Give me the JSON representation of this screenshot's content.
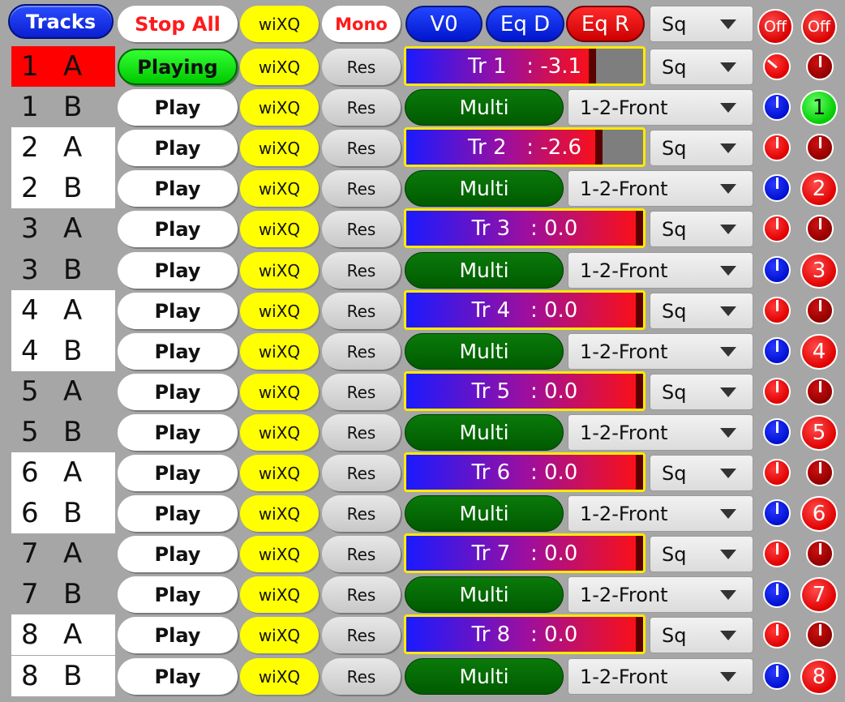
{
  "header": {
    "tracks_label": "Tracks",
    "stop_all_label": "Stop All",
    "wixq_label": "wiXQ",
    "mono_label": "Mono",
    "v0_label": "V0",
    "eqd_label": "Eq D",
    "eqr_label": "Eq R",
    "sq_value": "Sq",
    "off1_label": "Off",
    "off2_label": "Off"
  },
  "colors": {
    "label_red": "#ff0000",
    "label_white": "#ffffff",
    "label_gray": "#a6a6a6",
    "meter_border": "#ffea00",
    "multi_green": "#006400",
    "wixq_yellow": "#ffff00"
  },
  "rows": [
    {
      "num": "1",
      "side": "A",
      "label_bg": "label_red",
      "play": "Playing",
      "wixq": "wiXQ",
      "res": "Res",
      "kind": "meter",
      "meter_text": "Tr 1   : -3.1",
      "level": 0.8,
      "sq": "Sq",
      "knob1": "red",
      "knob2": "dred",
      "knob1_rot": -50,
      "knob2_rot": 0
    },
    {
      "num": "1",
      "side": "B",
      "label_bg": "label_gray",
      "play": "Play",
      "wixq": "wiXQ",
      "res": "Res",
      "kind": "multi",
      "multi": "Multi",
      "out": "1-2-Front",
      "knob1": "blue",
      "knob1_rot": 0,
      "num_btn": "1",
      "num_btn_color": "green"
    },
    {
      "num": "2",
      "side": "A",
      "label_bg": "label_white",
      "play": "Play",
      "wixq": "wiXQ",
      "res": "Res",
      "kind": "meter",
      "meter_text": "Tr 2   : -2.6",
      "level": 0.83,
      "sq": "Sq",
      "knob1": "red",
      "knob2": "dred",
      "knob1_rot": 0,
      "knob2_rot": 0
    },
    {
      "num": "2",
      "side": "B",
      "label_bg": "label_white",
      "play": "Play",
      "wixq": "wiXQ",
      "res": "Res",
      "kind": "multi",
      "multi": "Multi",
      "out": "1-2-Front",
      "knob1": "blue",
      "knob1_rot": 0,
      "num_btn": "2",
      "num_btn_color": "red"
    },
    {
      "num": "3",
      "side": "A",
      "label_bg": "label_gray",
      "play": "Play",
      "wixq": "wiXQ",
      "res": "Res",
      "kind": "meter",
      "meter_text": "Tr 3   : 0.0",
      "level": 1.0,
      "sq": "Sq",
      "knob1": "red",
      "knob2": "dred",
      "knob1_rot": 0,
      "knob2_rot": 0
    },
    {
      "num": "3",
      "side": "B",
      "label_bg": "label_gray",
      "play": "Play",
      "wixq": "wiXQ",
      "res": "Res",
      "kind": "multi",
      "multi": "Multi",
      "out": "1-2-Front",
      "knob1": "blue",
      "knob1_rot": 0,
      "num_btn": "3",
      "num_btn_color": "red"
    },
    {
      "num": "4",
      "side": "A",
      "label_bg": "label_white",
      "play": "Play",
      "wixq": "wiXQ",
      "res": "Res",
      "kind": "meter",
      "meter_text": "Tr 4   : 0.0",
      "level": 1.0,
      "sq": "Sq",
      "knob1": "red",
      "knob2": "dred",
      "knob1_rot": 0,
      "knob2_rot": 0
    },
    {
      "num": "4",
      "side": "B",
      "label_bg": "label_white",
      "play": "Play",
      "wixq": "wiXQ",
      "res": "Res",
      "kind": "multi",
      "multi": "Multi",
      "out": "1-2-Front",
      "knob1": "blue",
      "knob1_rot": 0,
      "num_btn": "4",
      "num_btn_color": "red"
    },
    {
      "num": "5",
      "side": "A",
      "label_bg": "label_gray",
      "play": "Play",
      "wixq": "wiXQ",
      "res": "Res",
      "kind": "meter",
      "meter_text": "Tr 5   : 0.0",
      "level": 1.0,
      "sq": "Sq",
      "knob1": "red",
      "knob2": "dred",
      "knob1_rot": 0,
      "knob2_rot": 0
    },
    {
      "num": "5",
      "side": "B",
      "label_bg": "label_gray",
      "play": "Play",
      "wixq": "wiXQ",
      "res": "Res",
      "kind": "multi",
      "multi": "Multi",
      "out": "1-2-Front",
      "knob1": "blue",
      "knob1_rot": 0,
      "num_btn": "5",
      "num_btn_color": "red"
    },
    {
      "num": "6",
      "side": "A",
      "label_bg": "label_white",
      "play": "Play",
      "wixq": "wiXQ",
      "res": "Res",
      "kind": "meter",
      "meter_text": "Tr 6   : 0.0",
      "level": 1.0,
      "sq": "Sq",
      "knob1": "red",
      "knob2": "dred",
      "knob1_rot": 0,
      "knob2_rot": 0
    },
    {
      "num": "6",
      "side": "B",
      "label_bg": "label_white",
      "play": "Play",
      "wixq": "wiXQ",
      "res": "Res",
      "kind": "multi",
      "multi": "Multi",
      "out": "1-2-Front",
      "knob1": "blue",
      "knob1_rot": 0,
      "num_btn": "6",
      "num_btn_color": "red"
    },
    {
      "num": "7",
      "side": "A",
      "label_bg": "label_gray",
      "play": "Play",
      "wixq": "wiXQ",
      "res": "Res",
      "kind": "meter",
      "meter_text": "Tr 7   : 0.0",
      "level": 1.0,
      "sq": "Sq",
      "knob1": "red",
      "knob2": "dred",
      "knob1_rot": 0,
      "knob2_rot": 0
    },
    {
      "num": "7",
      "side": "B",
      "label_bg": "label_gray",
      "play": "Play",
      "wixq": "wiXQ",
      "res": "Res",
      "kind": "multi",
      "multi": "Multi",
      "out": "1-2-Front",
      "knob1": "blue",
      "knob1_rot": 0,
      "num_btn": "7",
      "num_btn_color": "red"
    },
    {
      "num": "8",
      "side": "A",
      "label_bg": "label_white",
      "play": "Play",
      "wixq": "wiXQ",
      "res": "Res",
      "kind": "meter",
      "meter_text": "Tr 8   : 0.0",
      "level": 1.0,
      "sq": "Sq",
      "knob1": "red",
      "knob2": "dred",
      "knob1_rot": 0,
      "knob2_rot": 0
    },
    {
      "num": "8",
      "side": "B",
      "label_bg": "label_white",
      "play": "Play",
      "wixq": "wiXQ",
      "res": "Res",
      "kind": "multi",
      "multi": "Multi",
      "out": "1-2-Front",
      "knob1": "blue",
      "knob1_rot": 0,
      "num_btn": "8",
      "num_btn_color": "red"
    }
  ]
}
